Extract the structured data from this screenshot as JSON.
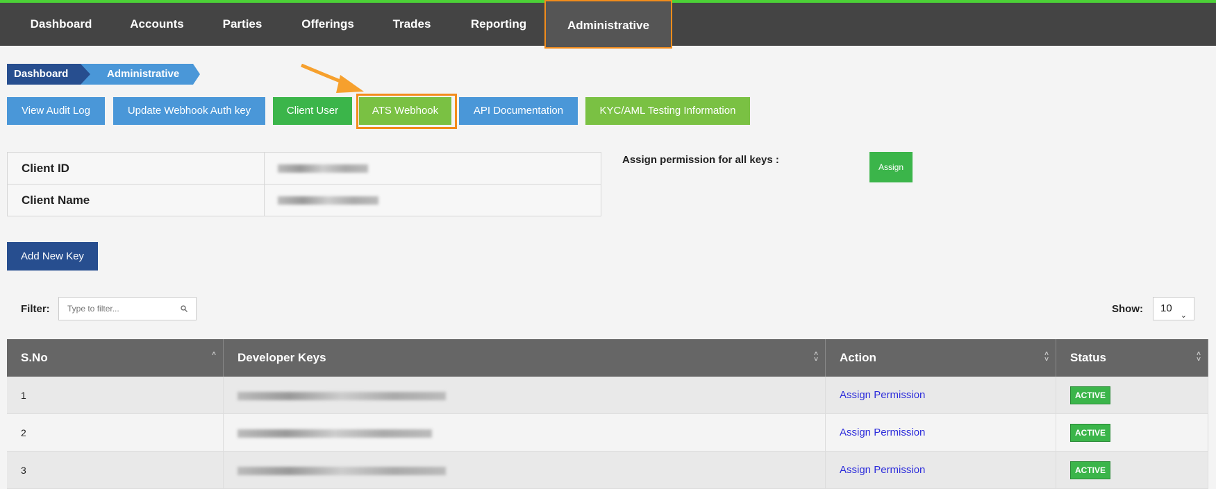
{
  "nav": {
    "items": [
      "Dashboard",
      "Accounts",
      "Parties",
      "Offerings",
      "Trades",
      "Reporting",
      "Administrative"
    ]
  },
  "breadcrumb": [
    "Dashboard",
    "Administrative"
  ],
  "actions": {
    "audit": "View Audit Log",
    "webhook_auth": "Update Webhook Auth key",
    "client_user": "Client User",
    "ats_webhook": "ATS Webhook",
    "api_docs": "API Documentation",
    "kyc": "KYC/AML Testing Information"
  },
  "client": {
    "id_label": "Client ID",
    "name_label": "Client Name"
  },
  "assign": {
    "label": "Assign permission for all keys :",
    "button": "Assign"
  },
  "add_key": "Add New Key",
  "filter": {
    "label": "Filter:",
    "placeholder": "Type to filter..."
  },
  "show": {
    "label": "Show:",
    "value": "10"
  },
  "table": {
    "headers": [
      "S.No",
      "Developer Keys",
      "Action",
      "Status"
    ],
    "rows": [
      {
        "sno": "1",
        "action": "Assign Permission",
        "status": "ACTIVE"
      },
      {
        "sno": "2",
        "action": "Assign Permission",
        "status": "ACTIVE"
      },
      {
        "sno": "3",
        "action": "Assign Permission",
        "status": "ACTIVE"
      }
    ]
  },
  "colors": {
    "accent_orange": "#f28c1b",
    "nav_bg": "#444444",
    "blue": "#4a97d8",
    "dark_blue": "#274e8f",
    "green": "#3bb54a",
    "light_green": "#7ac143"
  }
}
